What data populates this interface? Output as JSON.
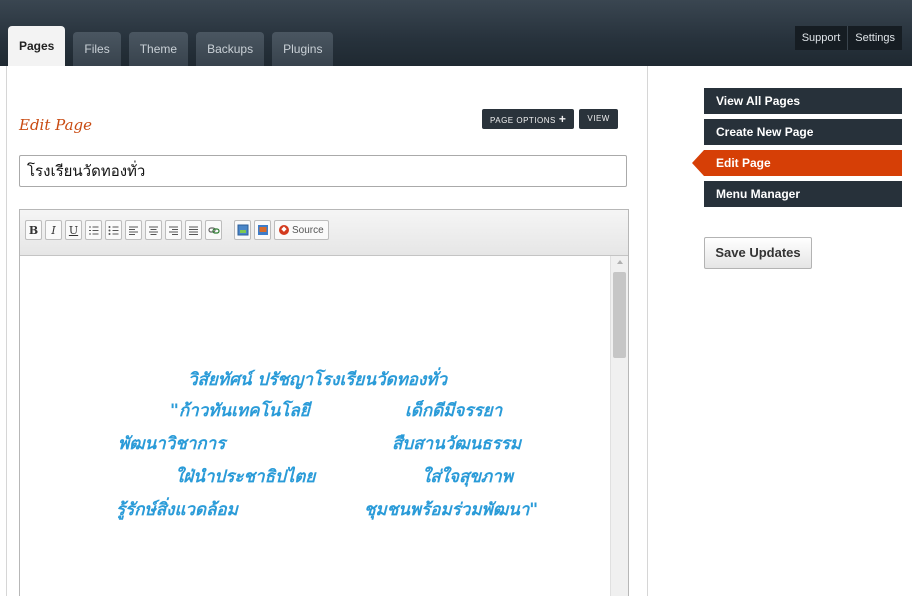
{
  "header": {
    "tabs": [
      {
        "label": "Pages",
        "active": true
      },
      {
        "label": "Files",
        "active": false
      },
      {
        "label": "Theme",
        "active": false
      },
      {
        "label": "Backups",
        "active": false
      },
      {
        "label": "Plugins",
        "active": false
      }
    ],
    "nav": {
      "support": "Support",
      "settings": "Settings"
    }
  },
  "main": {
    "title": "Edit Page",
    "page_options_label": "PAGE OPTIONS",
    "page_options_icon": "plus-icon",
    "view_label": "VIEW",
    "page_title_value": "โรงเรียนวัดทองทั่ว"
  },
  "editor": {
    "toolbar": {
      "bold": "B",
      "italic": "I",
      "underline": "U",
      "source": "Source"
    },
    "content_lines": [
      "วิสัยทัศน์ ปรัชญาโรงเรียนวัดทองทั่ว",
      "\"ก้าวทันเทคโนโลยี",
      "เด็กดีมีจรรยา",
      "พัฒนาวิชาการ",
      "สืบสานวัฒนธรรม",
      "ใฝ่นำประชาธิปไตย",
      "ใส่ใจสุขภาพ",
      "รู้รักษ์สิ่งแวดล้อม",
      "ชุมชนพร้อมร่วมพัฒนา\""
    ]
  },
  "sidebar": {
    "items": [
      {
        "label": "View All Pages",
        "active": false
      },
      {
        "label": "Create New Page",
        "active": false
      },
      {
        "label": "Edit Page",
        "active": true
      },
      {
        "label": "Menu Manager",
        "active": false
      }
    ],
    "save_label": "Save Updates"
  },
  "colors": {
    "accent": "#d63f06",
    "title_text": "#c94b12",
    "content_text": "#2a9bd8",
    "topbar": "#27323c"
  }
}
